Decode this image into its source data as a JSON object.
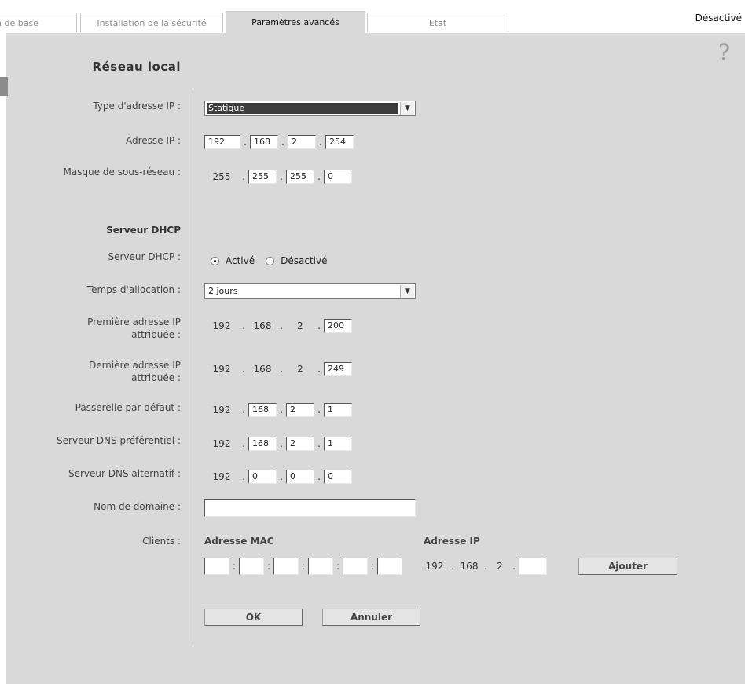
{
  "tabs": {
    "basic": "n de base",
    "security": "Installation de la sécurité",
    "advanced": "Paramètres avancés",
    "state": "Etat"
  },
  "status": "Désactivé",
  "help_icon": "question-mark",
  "lan": {
    "title": "Réseau local",
    "ip_type_label": "Type d'adresse IP :",
    "ip_type_value": "Statique",
    "ip_label": "Adresse IP :",
    "ip": [
      "192",
      "168",
      "2",
      "254"
    ],
    "mask_label": "Masque de sous-réseau :",
    "mask": [
      "255",
      "255",
      "255",
      "0"
    ]
  },
  "dhcp": {
    "title": "Serveur DHCP",
    "server_label": "Serveur DHCP :",
    "on_label": "Activé",
    "off_label": "Désactivé",
    "lease_label": "Temps d'allocation :",
    "lease_value": "2 jours",
    "first_label_1": "Première adresse IP",
    "first_label_2": "attribuée :",
    "first": [
      "192",
      "168",
      "2",
      "200"
    ],
    "last_label_1": "Dernière adresse IP",
    "last_label_2": "attribuée :",
    "last": [
      "192",
      "168",
      "2",
      "249"
    ],
    "gateway_label": "Passerelle par défaut :",
    "gateway": [
      "192",
      "168",
      "2",
      "1"
    ],
    "dns1_label": "Serveur DNS préférentiel :",
    "dns1": [
      "192",
      "168",
      "2",
      "1"
    ],
    "dns2_label": "Serveur DNS alternatif :",
    "dns2": [
      "192",
      "0",
      "0",
      "0"
    ],
    "domain_label": "Nom de domaine :",
    "domain_value": "",
    "clients_label": "Clients :",
    "mac_header": "Adresse MAC",
    "ip_header": "Adresse IP",
    "client_ip": [
      "192",
      "168",
      "2",
      ""
    ],
    "add_label": "Ajouter"
  },
  "buttons": {
    "ok": "OK",
    "cancel": "Annuler"
  },
  "separators": {
    "dot": ".",
    "colon": ":"
  }
}
